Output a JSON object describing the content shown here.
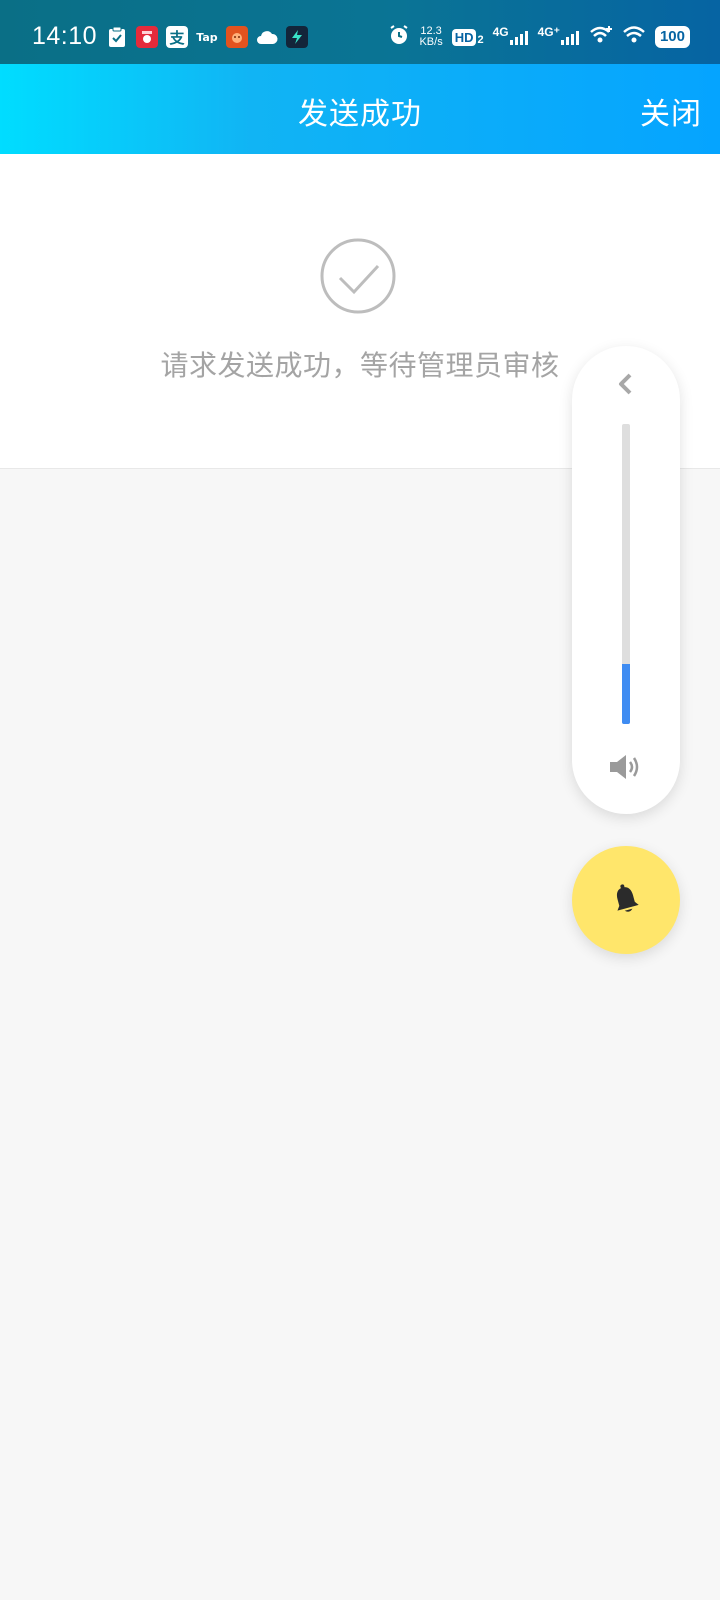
{
  "status_bar": {
    "time": "14:10",
    "notification_icons": [
      "clipboard-check-icon",
      "taobao-app-icon",
      "alipay-app-icon",
      "taptap-app-icon",
      "game-app-icon",
      "cloud-app-icon",
      "flash-app-icon"
    ],
    "alipay_glyph": "支",
    "taptap_glyph": "Tap",
    "network_speed_value": "12.3",
    "network_speed_unit": "KB/s",
    "hd_label": "HD",
    "hd_sub": "2",
    "network1": "4G",
    "network2": "4G⁺",
    "battery": "100"
  },
  "header": {
    "title": "发送成功",
    "close_label": "关闭"
  },
  "content": {
    "message": "请求发送成功，等待管理员审核"
  },
  "volume_panel": {
    "level": 0.2,
    "fill_color": "#3f8cf2"
  },
  "colors": {
    "header_start": "#00ddff",
    "header_end": "#05a4ff",
    "ring_button_bg": "#ffe66b",
    "message_text": "#a4a4a4"
  }
}
